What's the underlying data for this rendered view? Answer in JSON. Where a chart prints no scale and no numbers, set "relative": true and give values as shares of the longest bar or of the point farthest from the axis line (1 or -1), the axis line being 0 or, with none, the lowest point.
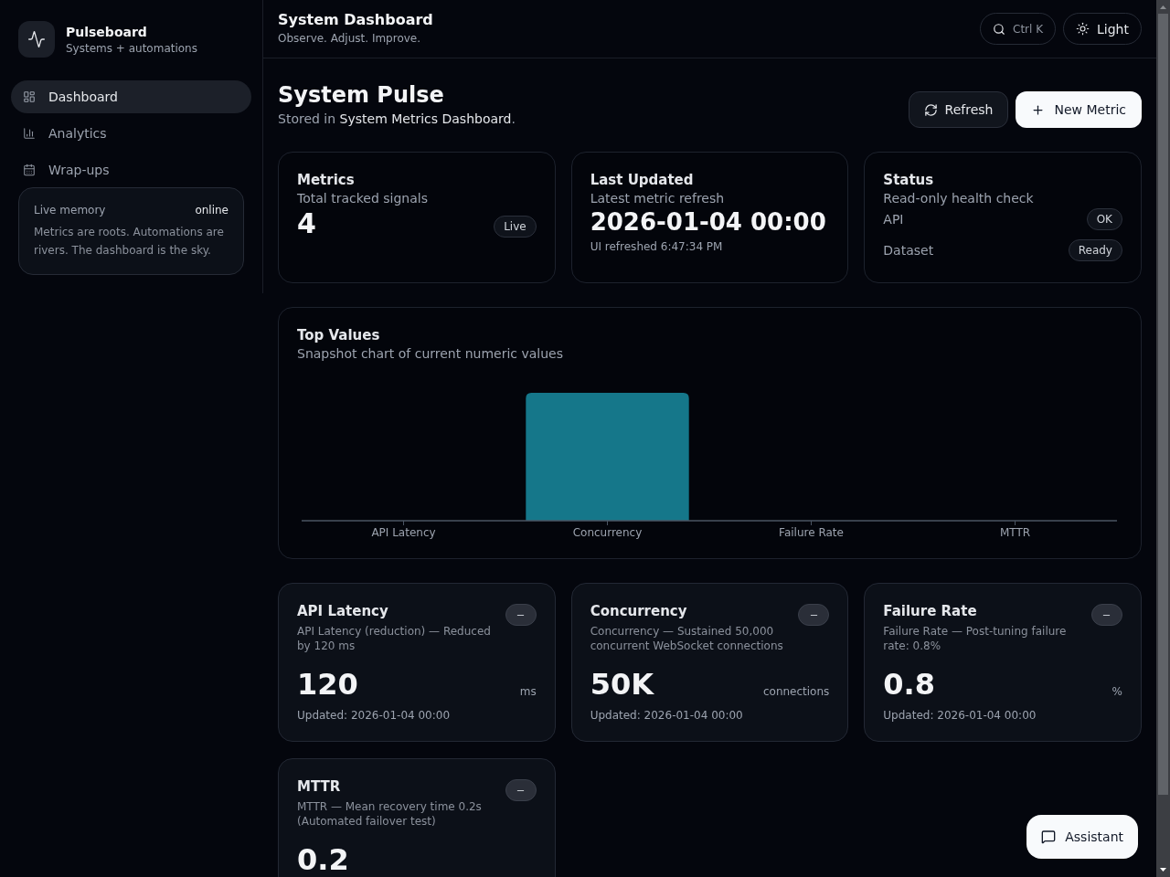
{
  "sidebar": {
    "brand": {
      "name": "Pulseboard",
      "tagline": "Systems + automations"
    },
    "nav": [
      {
        "label": "Dashboard",
        "selected": true
      },
      {
        "label": "Analytics",
        "selected": false
      },
      {
        "label": "Wrap-ups",
        "selected": false
      }
    ],
    "memory": {
      "title": "Live memory",
      "status": "online",
      "text": "Metrics are roots. Automations are rivers. The dashboard is the sky."
    }
  },
  "header": {
    "title": "System Dashboard",
    "subtitle": "Observe. Adjust. Improve.",
    "search_shortcut": "Ctrl K",
    "theme_button": "Light"
  },
  "page": {
    "title": "System Pulse",
    "subtitle": "Stored in **System Metrics Dashboard**.",
    "actions": [
      {
        "kind": "secondary",
        "label": "Refresh"
      },
      {
        "kind": "primary",
        "label": "New Metric"
      }
    ]
  },
  "summary_cards": [
    {
      "kind": "count",
      "title": "Metrics",
      "subtitle": "Total tracked signals",
      "value": "4",
      "badge": "Live"
    },
    {
      "kind": "timestamp",
      "title": "Last Updated",
      "subtitle": "Latest metric refresh",
      "value": "2026-01-04 00:00",
      "note": "UI refreshed 6:47:34 PM"
    },
    {
      "kind": "status",
      "title": "Status",
      "subtitle": "Read-only health check",
      "checks": [
        {
          "label": "API",
          "badge": "OK"
        },
        {
          "label": "Dataset",
          "badge": "Ready"
        }
      ]
    }
  ],
  "top_values": {
    "title": "Top Values",
    "subtitle": "Snapshot chart of current numeric values",
    "chart_data": {
      "type": "bar",
      "relative": true,
      "categories": [
        "API Latency",
        "Concurrency",
        "Failure Rate",
        "MTTR"
      ],
      "values": [
        0,
        1,
        0,
        0
      ],
      "color": "#15778a"
    }
  },
  "metrics": [
    {
      "name": "API Latency",
      "description": "API Latency (reduction) — Reduced by 120 ms",
      "value": "120",
      "unit": "ms",
      "updated": "Updated: 2026-01-04 00:00"
    },
    {
      "name": "Concurrency",
      "description": "Concurrency — Sustained 50,000 concurrent WebSocket connections",
      "value": "50K",
      "unit": "connections",
      "updated": "Updated: 2026-01-04 00:00"
    },
    {
      "name": "Failure Rate",
      "description": "Failure Rate — Post-tuning failure rate: 0.8%",
      "value": "0.8",
      "unit": "%",
      "updated": "Updated: 2026-01-04 00:00"
    },
    {
      "name": "MTTR",
      "description": "MTTR — Mean recovery time 0.2s (Automated failover test)",
      "value": "0.2"
    }
  ],
  "assistant_button": "Assistant"
}
